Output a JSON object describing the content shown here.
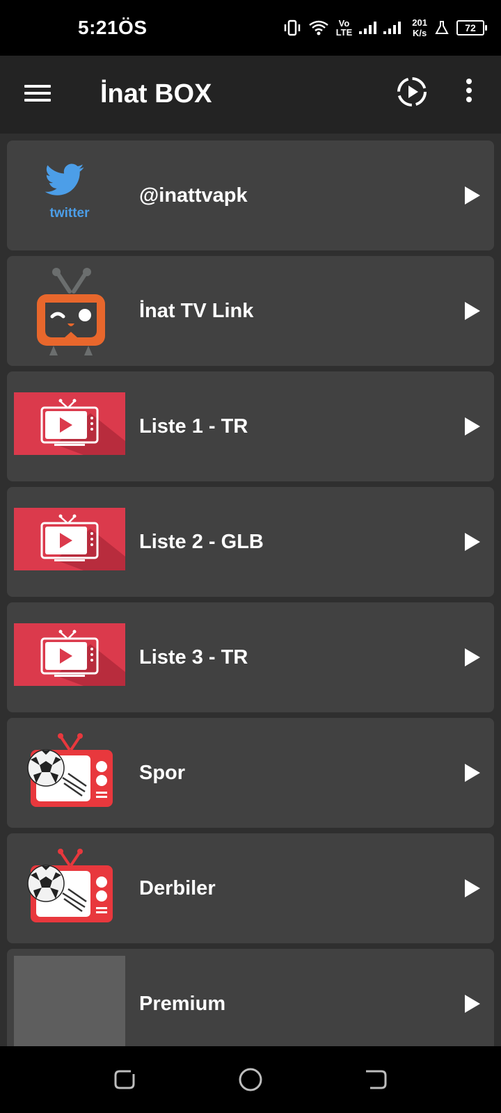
{
  "status_bar": {
    "time": "5:21ÖS",
    "volte_top": "Vo",
    "volte_bottom": "LTE",
    "speed_value": "201",
    "speed_unit": "K/s",
    "battery": "72"
  },
  "app_bar": {
    "title": "İnat BOX",
    "icons": [
      "menu-icon",
      "play-circle-icon",
      "more-vert-icon"
    ]
  },
  "items": [
    {
      "label": "@inattvapk",
      "logo_text": "twitter",
      "icon": "twitter-icon"
    },
    {
      "label": "İnat TV Link",
      "icon": "inat-tv-logo-icon"
    },
    {
      "label": "Liste 1 - TR",
      "icon": "tv-play-icon"
    },
    {
      "label": "Liste 2 - GLB",
      "icon": "tv-play-icon"
    },
    {
      "label": "Liste 3 - TR",
      "icon": "tv-play-icon"
    },
    {
      "label": "Spor",
      "icon": "football-tv-icon"
    },
    {
      "label": "Derbiler",
      "icon": "football-tv-icon"
    },
    {
      "label": "Premium",
      "icon": "placeholder-thumbnail"
    }
  ],
  "colors": {
    "background": "#2f2f2f",
    "app_bar": "#232323",
    "card": "#414141",
    "twitter_blue": "#4c9ee8",
    "tv_red": "#db3a4c",
    "inat_orange": "#e8672c"
  },
  "nav_bar": {
    "icons": [
      "recent-apps-icon",
      "home-icon",
      "back-icon"
    ]
  }
}
